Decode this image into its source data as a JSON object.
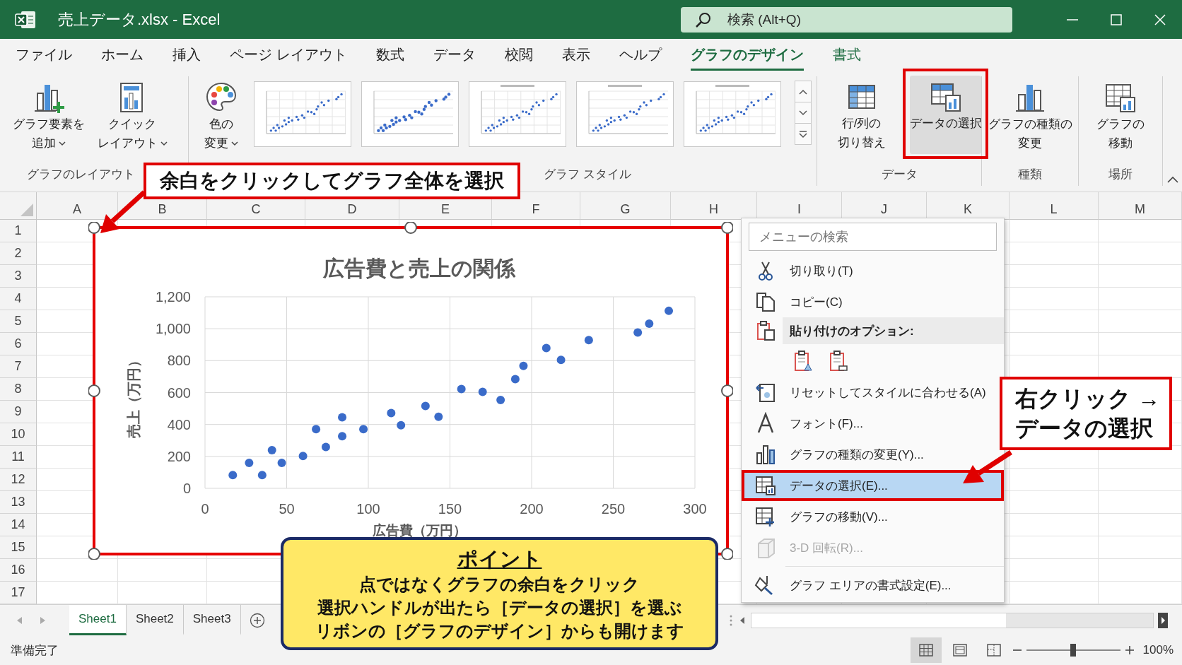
{
  "window": {
    "title": "売上データ.xlsx - Excel"
  },
  "search": {
    "placeholder": "検索 (Alt+Q)"
  },
  "ribbon_tabs": [
    {
      "label": "ファイル",
      "selected": false,
      "contextual": false
    },
    {
      "label": "ホーム",
      "selected": false,
      "contextual": false
    },
    {
      "label": "挿入",
      "selected": false,
      "contextual": false
    },
    {
      "label": "ページ レイアウト",
      "selected": false,
      "contextual": false
    },
    {
      "label": "数式",
      "selected": false,
      "contextual": false
    },
    {
      "label": "データ",
      "selected": false,
      "contextual": false
    },
    {
      "label": "校閲",
      "selected": false,
      "contextual": false
    },
    {
      "label": "表示",
      "selected": false,
      "contextual": false
    },
    {
      "label": "ヘルプ",
      "selected": false,
      "contextual": false
    },
    {
      "label": "グラフのデザイン",
      "selected": true,
      "contextual": true
    },
    {
      "label": "書式",
      "selected": false,
      "contextual": true
    }
  ],
  "ribbon_groups": [
    {
      "label": "グラフのレイアウト",
      "buttons": [
        {
          "lines": [
            "グラフ要素を",
            "追加"
          ],
          "dropdown": true,
          "highlighted": false
        },
        {
          "lines": [
            "クイック",
            "レイアウト"
          ],
          "dropdown": true,
          "highlighted": false
        }
      ]
    },
    {
      "label": "グラフ スタイル",
      "buttons": [
        {
          "lines": [
            "色の",
            "変更"
          ],
          "dropdown": true,
          "highlighted": false
        }
      ],
      "thumbnails": [
        {
          "kind": "chart_style"
        },
        {
          "kind": "chart_style"
        },
        {
          "kind": "chart_style"
        },
        {
          "kind": "chart_style"
        },
        {
          "kind": "chart_style"
        }
      ]
    },
    {
      "label": "データ",
      "buttons": [
        {
          "lines": [
            "行/列の",
            "切り替え"
          ],
          "dropdown": false,
          "highlighted": false
        },
        {
          "lines": [
            "データの選択"
          ],
          "dropdown": false,
          "highlighted": true
        }
      ]
    },
    {
      "label": "種類",
      "buttons": [
        {
          "lines": [
            "グラフの種類の",
            "変更"
          ],
          "dropdown": false,
          "highlighted": false
        }
      ]
    },
    {
      "label": "場所",
      "buttons": [
        {
          "lines": [
            "グラフの",
            "移動"
          ],
          "dropdown": false,
          "highlighted": false
        }
      ]
    }
  ],
  "sheet": {
    "columns": [
      "A",
      "B",
      "C",
      "D",
      "E",
      "F",
      "G",
      "H",
      "I",
      "J",
      "K",
      "L",
      "M"
    ],
    "rows": [
      "1",
      "2",
      "3",
      "4",
      "5",
      "6",
      "7",
      "8",
      "9",
      "10",
      "11",
      "12",
      "13",
      "14",
      "15",
      "16",
      "17"
    ]
  },
  "chart": {
    "selected": true,
    "highlighted": true,
    "chart_data": {
      "type": "scatter",
      "title": "広告費と売上の関係",
      "xlabel": "広告費（万円）",
      "ylabel": "売上（万円）",
      "x": [
        17,
        27,
        35,
        41,
        47,
        60,
        68,
        74,
        84,
        84,
        97,
        114,
        120,
        135,
        143,
        157,
        170,
        181,
        190,
        195,
        209,
        218,
        235,
        265,
        272,
        284
      ],
      "grid": true,
      "series": [
        {
          "color": "#3a6bc9",
          "values": [
            83,
            159,
            83,
            239,
            159,
            203,
            371,
            259,
            445,
            327,
            371,
            472,
            395,
            516,
            448,
            622,
            604,
            554,
            684,
            767,
            879,
            805,
            929,
            976,
            1032,
            1112
          ]
        }
      ],
      "xlim": [
        0,
        300
      ],
      "ylim": [
        0,
        1200
      ],
      "xticks": [
        0,
        50,
        100,
        150,
        200,
        250,
        300
      ],
      "yticks": [
        {
          "value": 0,
          "label": "0"
        },
        {
          "value": 200,
          "label": "200"
        },
        {
          "value": 400,
          "label": "400"
        },
        {
          "value": 600,
          "label": "600"
        },
        {
          "value": 800,
          "label": "800"
        },
        {
          "value": 1000,
          "label": "1,000"
        },
        {
          "value": 1200,
          "label": "1,200"
        }
      ]
    }
  },
  "context_menu": {
    "search": {
      "placeholder": "メニューの検索"
    },
    "items": [
      {
        "kind": "command",
        "label": "切り取り(T)",
        "selected": false,
        "disabled": false,
        "highlighted": false
      },
      {
        "kind": "command",
        "label": "コピー(C)",
        "selected": false,
        "disabled": false,
        "highlighted": false
      },
      {
        "kind": "header",
        "label": "貼り付けのオプション:"
      },
      {
        "kind": "paste_options"
      },
      {
        "kind": "command",
        "label": "リセットしてスタイルに合わせる(A)",
        "selected": false,
        "disabled": false,
        "highlighted": false
      },
      {
        "kind": "command",
        "label": "フォント(F)...",
        "selected": false,
        "disabled": false,
        "highlighted": false
      },
      {
        "kind": "command",
        "label": "グラフの種類の変更(Y)...",
        "selected": false,
        "disabled": false,
        "highlighted": false
      },
      {
        "kind": "command",
        "label": "データの選択(E)...",
        "selected": true,
        "disabled": false,
        "highlighted": true
      },
      {
        "kind": "command",
        "label": "グラフの移動(V)...",
        "selected": false,
        "disabled": false,
        "highlighted": false
      },
      {
        "kind": "command",
        "label": "3-D 回転(R)...",
        "selected": false,
        "disabled": true,
        "highlighted": false
      },
      {
        "kind": "command",
        "label": "グラフ エリアの書式設定(E)...",
        "selected": false,
        "disabled": false,
        "highlighted": false
      }
    ]
  },
  "sheet_tabs": [
    {
      "label": "Sheet1",
      "selected": true
    },
    {
      "label": "Sheet2",
      "selected": false
    },
    {
      "label": "Sheet3",
      "selected": false
    }
  ],
  "status_bar": {
    "text": "準備完了",
    "views": [
      {
        "selected": true
      },
      {
        "selected": false
      },
      {
        "selected": false
      }
    ],
    "zoom": {
      "level": 0.5,
      "reading": "100%"
    }
  },
  "callouts": [
    {
      "lines": [
        "余白をクリックしてグラフ全体を選択"
      ]
    },
    {
      "lines": [
        "右クリック →",
        "データの選択"
      ]
    }
  ],
  "note": {
    "title": "ポイント",
    "lines": [
      "点ではなくグラフの余白をクリック",
      "選択ハンドルが出たら［データの選択］を選ぶ",
      "リボンの［グラフのデザイン］からも開けます"
    ]
  }
}
